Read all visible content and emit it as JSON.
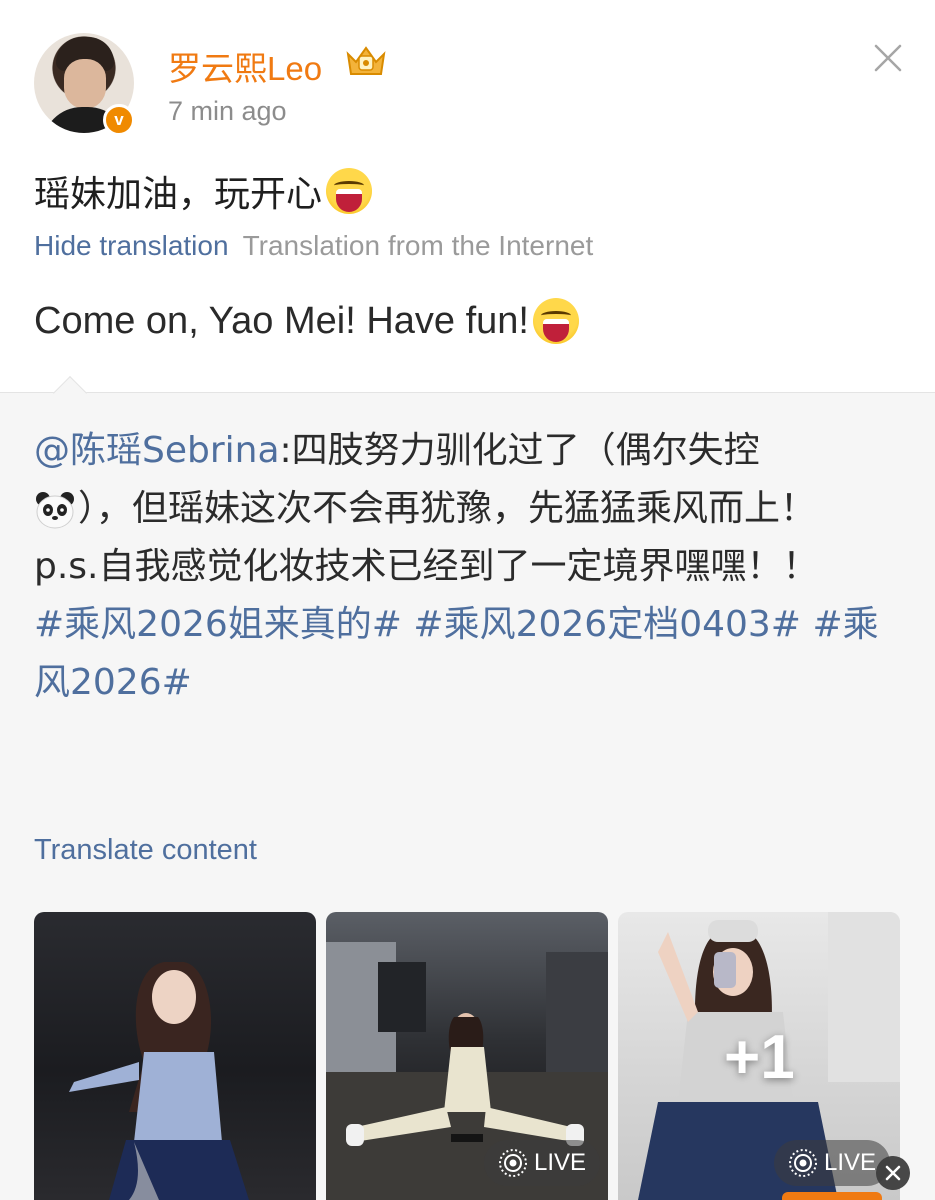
{
  "post": {
    "username": "罗云熙Leo",
    "time": "7 min ago",
    "text": "瑶妹加油，玩开心",
    "hide_translation": "Hide translation",
    "translation_source": "Translation from the Internet",
    "translated_text": "Come on, Yao Mei! Have fun!"
  },
  "repost": {
    "mention": "@陈瑶Sebrina",
    "text_part1": ":四肢努力驯化过了（偶尔失控",
    "text_part2": "），但瑶妹这次不会再犹豫，先猛猛乘风而上！",
    "text_part3": "p.s.自我感觉化妆技术已经到了一定境界嘿嘿！！",
    "hashtags": [
      "#乘风2026姐来真的#",
      "#乘风2026定档0403#",
      "#乘风2026#"
    ],
    "translate_content": "Translate content",
    "photos": {
      "live_label": "LIVE",
      "extra_count": "+1"
    }
  },
  "icons": [
    "verified-badge-icon",
    "crown-icon",
    "close-icon",
    "grin-emoji-icon",
    "panda-emoji-icon",
    "live-icon",
    "dismiss-icon"
  ],
  "colors": {
    "username": "#f07a12",
    "link": "#4f6f9e",
    "meta": "#8c8c8c",
    "repost_bg": "#f6f6f6"
  }
}
